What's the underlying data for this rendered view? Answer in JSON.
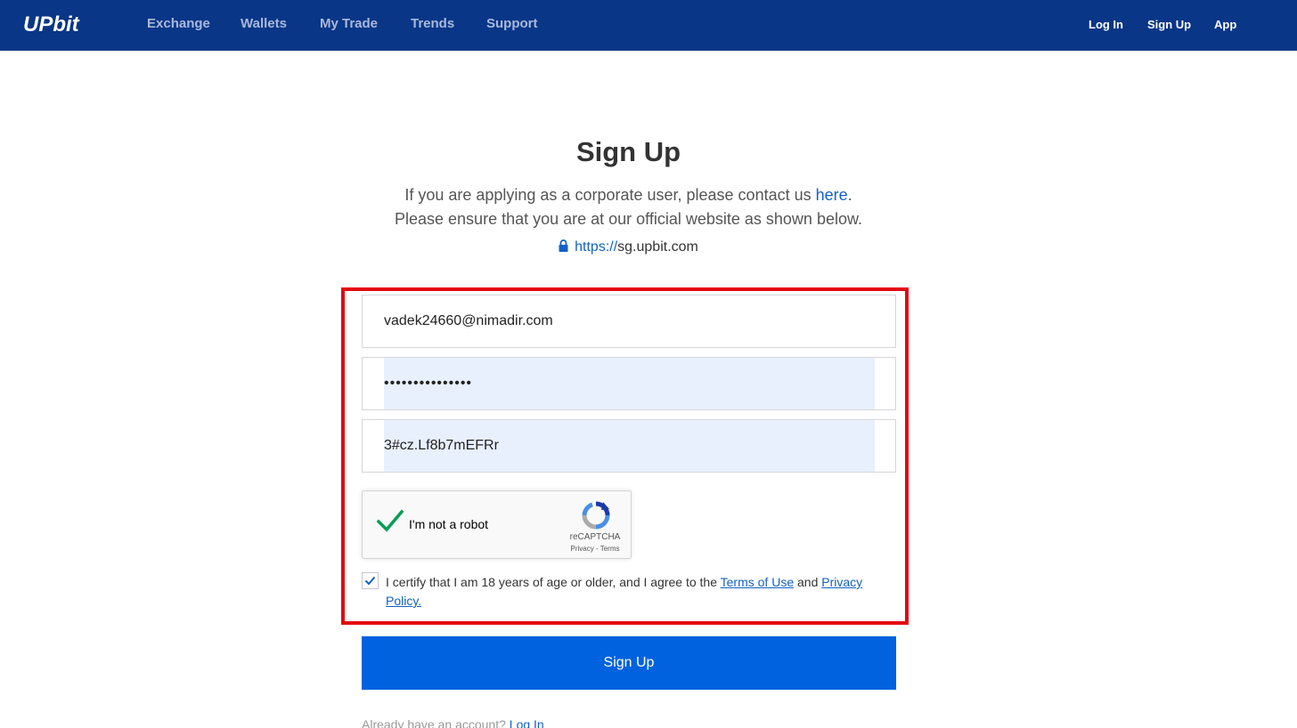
{
  "header": {
    "logo": "UPbit",
    "nav": [
      "Exchange",
      "Wallets",
      "My Trade",
      "Trends",
      "Support"
    ],
    "auth": {
      "login": "Log In",
      "signup": "Sign Up",
      "app": "App"
    }
  },
  "main": {
    "title": "Sign Up",
    "corporate_text": "If you are applying as a corporate user, please contact us ",
    "corporate_link": "here",
    "corporate_end": ".",
    "official_text": "Please ensure that you are at our official website as shown below.",
    "url_scheme": "https://",
    "url_host": "sg.upbit.com"
  },
  "form": {
    "email_value": "vadek24660@nimadir.com",
    "password_value": "3#cz.Lf8b7mEFRr",
    "confirm_value": "3#cz.Lf8b7mEFRr",
    "recaptcha": {
      "label": "I'm not a robot",
      "brand": "reCAPTCHA",
      "privacy": "Privacy",
      "sep": " - ",
      "terms": "Terms"
    },
    "terms": {
      "prefix": "I certify that I am 18 years of age or older, and I agree to the ",
      "terms_link": "Terms of Use",
      "and": " and ",
      "privacy_link": "Privacy Policy."
    },
    "submit_label": "Sign Up"
  },
  "footer": {
    "prefix": "Already have an account? ",
    "login_link": "Log In"
  },
  "colors": {
    "header_bg": "#093687",
    "accent": "#0062df",
    "link": "#1261c4",
    "highlight": "#e30611",
    "check": "#009e55"
  }
}
